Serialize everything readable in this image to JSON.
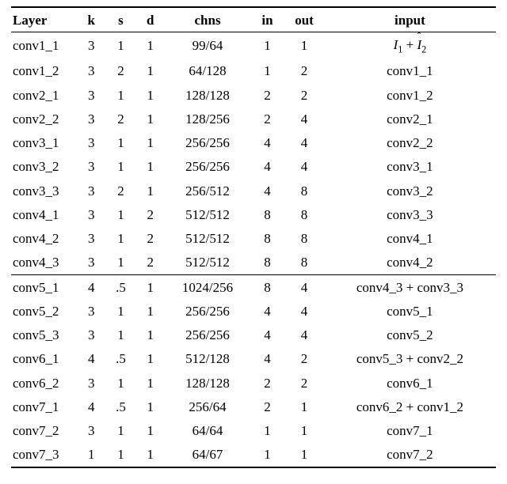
{
  "chart_data": {
    "type": "table",
    "title": "",
    "columns": [
      "Layer",
      "k",
      "s",
      "d",
      "chns",
      "in",
      "out",
      "input"
    ],
    "groups": [
      {
        "rows": [
          {
            "layer": "conv1_1",
            "k": "3",
            "s": "1",
            "d": "1",
            "chns": "99/64",
            "in": "1",
            "out": "1",
            "input": "I1 + I2_hat"
          },
          {
            "layer": "conv1_2",
            "k": "3",
            "s": "2",
            "d": "1",
            "chns": "64/128",
            "in": "1",
            "out": "2",
            "input": "conv1_1"
          },
          {
            "layer": "conv2_1",
            "k": "3",
            "s": "1",
            "d": "1",
            "chns": "128/128",
            "in": "2",
            "out": "2",
            "input": "conv1_2"
          },
          {
            "layer": "conv2_2",
            "k": "3",
            "s": "2",
            "d": "1",
            "chns": "128/256",
            "in": "2",
            "out": "4",
            "input": "conv2_1"
          },
          {
            "layer": "conv3_1",
            "k": "3",
            "s": "1",
            "d": "1",
            "chns": "256/256",
            "in": "4",
            "out": "4",
            "input": "conv2_2"
          },
          {
            "layer": "conv3_2",
            "k": "3",
            "s": "1",
            "d": "1",
            "chns": "256/256",
            "in": "4",
            "out": "4",
            "input": "conv3_1"
          },
          {
            "layer": "conv3_3",
            "k": "3",
            "s": "2",
            "d": "1",
            "chns": "256/512",
            "in": "4",
            "out": "8",
            "input": "conv3_2"
          },
          {
            "layer": "conv4_1",
            "k": "3",
            "s": "1",
            "d": "2",
            "chns": "512/512",
            "in": "8",
            "out": "8",
            "input": "conv3_3"
          },
          {
            "layer": "conv4_2",
            "k": "3",
            "s": "1",
            "d": "2",
            "chns": "512/512",
            "in": "8",
            "out": "8",
            "input": "conv4_1"
          },
          {
            "layer": "conv4_3",
            "k": "3",
            "s": "1",
            "d": "2",
            "chns": "512/512",
            "in": "8",
            "out": "8",
            "input": "conv4_2"
          }
        ]
      },
      {
        "rows": [
          {
            "layer": "conv5_1",
            "k": "4",
            "s": ".5",
            "d": "1",
            "chns": "1024/256",
            "in": "8",
            "out": "4",
            "input": "conv4_3 + conv3_3"
          },
          {
            "layer": "conv5_2",
            "k": "3",
            "s": "1",
            "d": "1",
            "chns": "256/256",
            "in": "4",
            "out": "4",
            "input": "conv5_1"
          },
          {
            "layer": "conv5_3",
            "k": "3",
            "s": "1",
            "d": "1",
            "chns": "256/256",
            "in": "4",
            "out": "4",
            "input": "conv5_2"
          },
          {
            "layer": "conv6_1",
            "k": "4",
            "s": ".5",
            "d": "1",
            "chns": "512/128",
            "in": "4",
            "out": "2",
            "input": "conv5_3 + conv2_2"
          },
          {
            "layer": "conv6_2",
            "k": "3",
            "s": "1",
            "d": "1",
            "chns": "128/128",
            "in": "2",
            "out": "2",
            "input": "conv6_1"
          },
          {
            "layer": "conv7_1",
            "k": "4",
            "s": ".5",
            "d": "1",
            "chns": "256/64",
            "in": "2",
            "out": "1",
            "input": "conv6_2 + conv1_2"
          },
          {
            "layer": "conv7_2",
            "k": "3",
            "s": "1",
            "d": "1",
            "chns": "64/64",
            "in": "1",
            "out": "1",
            "input": "conv7_1"
          },
          {
            "layer": "conv7_3",
            "k": "1",
            "s": "1",
            "d": "1",
            "chns": "64/67",
            "in": "1",
            "out": "1",
            "input": "conv7_2"
          }
        ]
      }
    ]
  },
  "headers": {
    "layer": "Layer",
    "k": "k",
    "s": "s",
    "d": "d",
    "chns": "chns",
    "in": "in",
    "out": "out",
    "input": "input"
  }
}
